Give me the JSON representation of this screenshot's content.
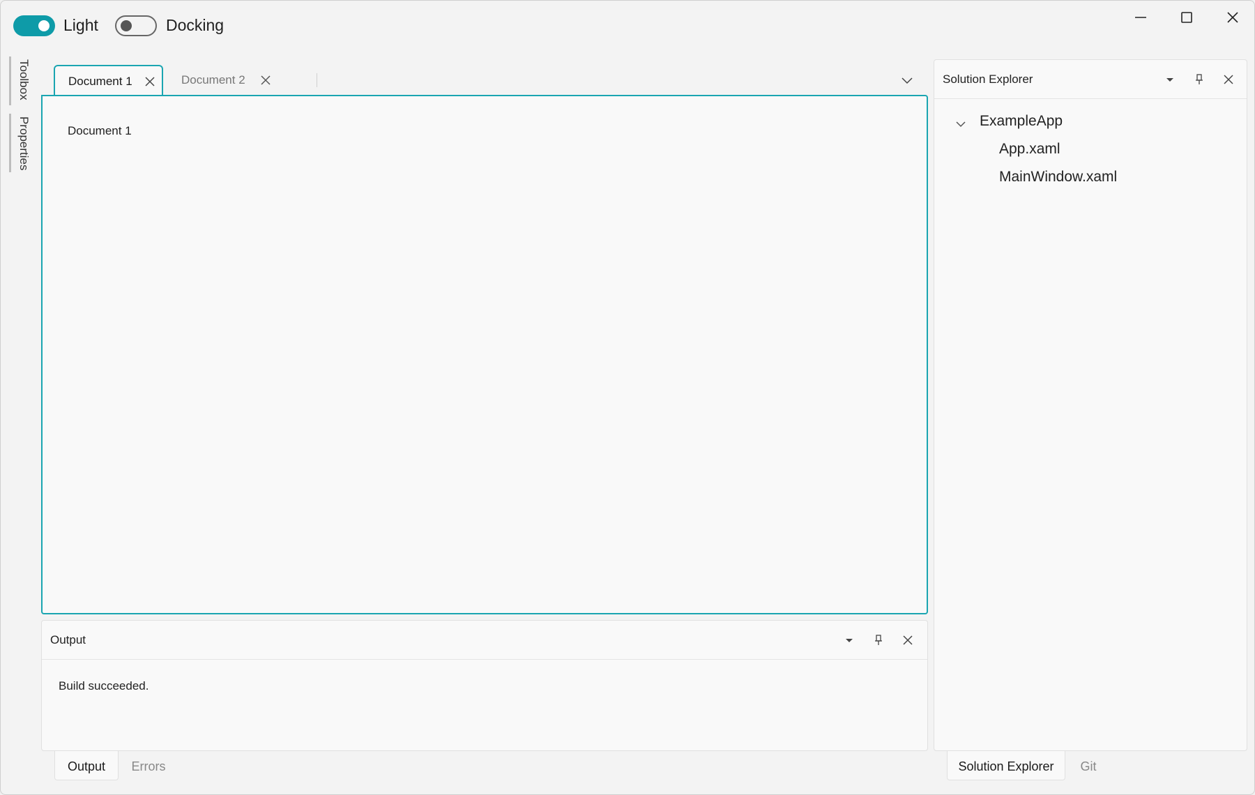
{
  "titlebar": {
    "toggles": [
      {
        "label": "Light",
        "on": true
      },
      {
        "label": "Docking",
        "on": false
      }
    ],
    "controls": [
      "minimize-icon",
      "maximize-icon",
      "close-icon"
    ]
  },
  "side_tabs": [
    {
      "label": "Toolbox"
    },
    {
      "label": "Properties"
    }
  ],
  "document_pane": {
    "tabs": [
      {
        "label": "Document 1",
        "active": true
      },
      {
        "label": "Document 2",
        "active": false
      }
    ],
    "content": "Document 1"
  },
  "output_pane": {
    "title": "Output",
    "text": "Build succeeded.",
    "tabs": [
      {
        "label": "Output",
        "active": true
      },
      {
        "label": "Errors",
        "active": false
      }
    ]
  },
  "solution_pane": {
    "title": "Solution Explorer",
    "tree": {
      "root": "ExampleApp",
      "children": [
        "App.xaml",
        "MainWindow.xaml"
      ]
    },
    "tabs": [
      {
        "label": "Solution Explorer",
        "active": true
      },
      {
        "label": "Git",
        "active": false
      }
    ]
  },
  "colors": {
    "accent": "#0e9ba8",
    "background": "#f3f3f3",
    "pane": "#f9f9f9"
  }
}
